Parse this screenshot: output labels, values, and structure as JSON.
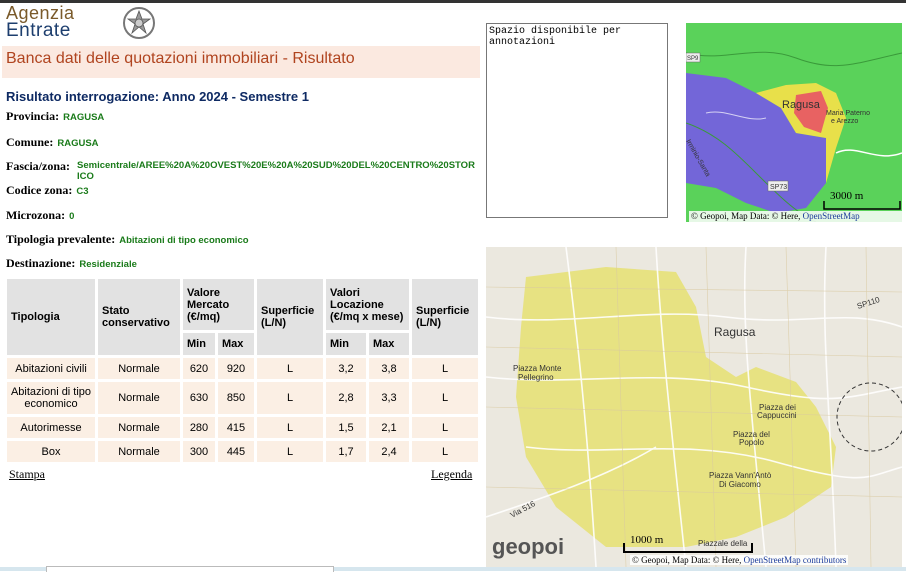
{
  "header": {
    "logo_line1": "Agenzia",
    "logo_line2": "Entrate",
    "page_title": "Banca dati delle quotazioni immobiliari - Risultato"
  },
  "result": {
    "title": "Risultato interrogazione: Anno 2024 - Semestre 1",
    "provincia_label": "Provincia:",
    "provincia": "RAGUSA",
    "comune_label": "Comune:",
    "comune": "RAGUSA",
    "fascia_label": "Fascia/zona:",
    "fascia": "Semicentrale/AREE%20A%20OVEST%20E%20A%20SUD%20DEL%20CENTRO%20STOR ICO",
    "codice_label": "Codice zona:",
    "codice": "C3",
    "microzona_label": "Microzona:",
    "microzona": "0",
    "tipologia_label": "Tipologia prevalente:",
    "tipologia": "Abitazioni di tipo economico",
    "destinazione_label": "Destinazione:",
    "destinazione": "Residenziale"
  },
  "table": {
    "h_tipologia": "Tipologia",
    "h_stato": "Stato conservativo",
    "h_valore": "Valore Mercato (€/mq)",
    "h_superficie1": "Superficie (L/N)",
    "h_locazione": "Valori Locazione (€/mq x mese)",
    "h_superficie2": "Superficie (L/N)",
    "h_min": "Min",
    "h_max": "Max",
    "rows": [
      {
        "tipologia": "Abitazioni civili",
        "stato": "Normale",
        "vmin": "620",
        "vmax": "920",
        "sup1": "L",
        "lmin": "3,2",
        "lmax": "3,8",
        "sup2": "L"
      },
      {
        "tipologia": "Abitazioni di tipo economico",
        "stato": "Normale",
        "vmin": "630",
        "vmax": "850",
        "sup1": "L",
        "lmin": "2,8",
        "lmax": "3,3",
        "sup2": "L"
      },
      {
        "tipologia": "Autorimesse",
        "stato": "Normale",
        "vmin": "280",
        "vmax": "415",
        "sup1": "L",
        "lmin": "1,5",
        "lmax": "2,1",
        "sup2": "L"
      },
      {
        "tipologia": "Box",
        "stato": "Normale",
        "vmin": "300",
        "vmax": "445",
        "sup1": "L",
        "lmin": "1,7",
        "lmax": "2,4",
        "sup2": "L"
      }
    ]
  },
  "links": {
    "stampa": "Stampa",
    "legenda": "Legenda"
  },
  "notes": {
    "value": "Spazio disponibile per\nannotazioni"
  },
  "map_small": {
    "label_city": "Ragusa",
    "label_village": "Maria Paterno",
    "label_village2": "e Arezzo",
    "label_road": "SP73",
    "label_road2": "SP9",
    "label_river": "Irminio-Santa",
    "scale": "3000 m",
    "attribution_prefix": "© Geopoi, Map Data: © Here, ",
    "attribution_link": "OpenStreetMap contributors"
  },
  "map_large": {
    "label_city": "Ragusa",
    "label_monte": "Piazza Monte",
    "label_monte2": "Pellegrino",
    "label_cappuccini": "Piazza dei",
    "label_cappuccini2": "Cappuccini",
    "label_popolo": "Piazza del",
    "label_popolo2": "Popolo",
    "label_vann": "Piazza Vann'Antò",
    "label_vann2": "Di Giacomo",
    "label_via": "Via 516",
    "label_sp": "SP110",
    "label_piazzale": "Piazzale della",
    "brand": "geopoi",
    "scale": "1000 m",
    "attribution_prefix": "© Geopoi, Map Data: © Here, ",
    "attribution_link": "OpenStreetMap contributors"
  },
  "colors": {
    "title_orange": "#b0441f",
    "value_green": "#1a7b1a",
    "title_navy": "#0e2a63",
    "zone_yellow": "#e6e64a",
    "zone_blue": "#7263d6",
    "zone_red": "#e86060",
    "zone_green": "#58d458"
  }
}
